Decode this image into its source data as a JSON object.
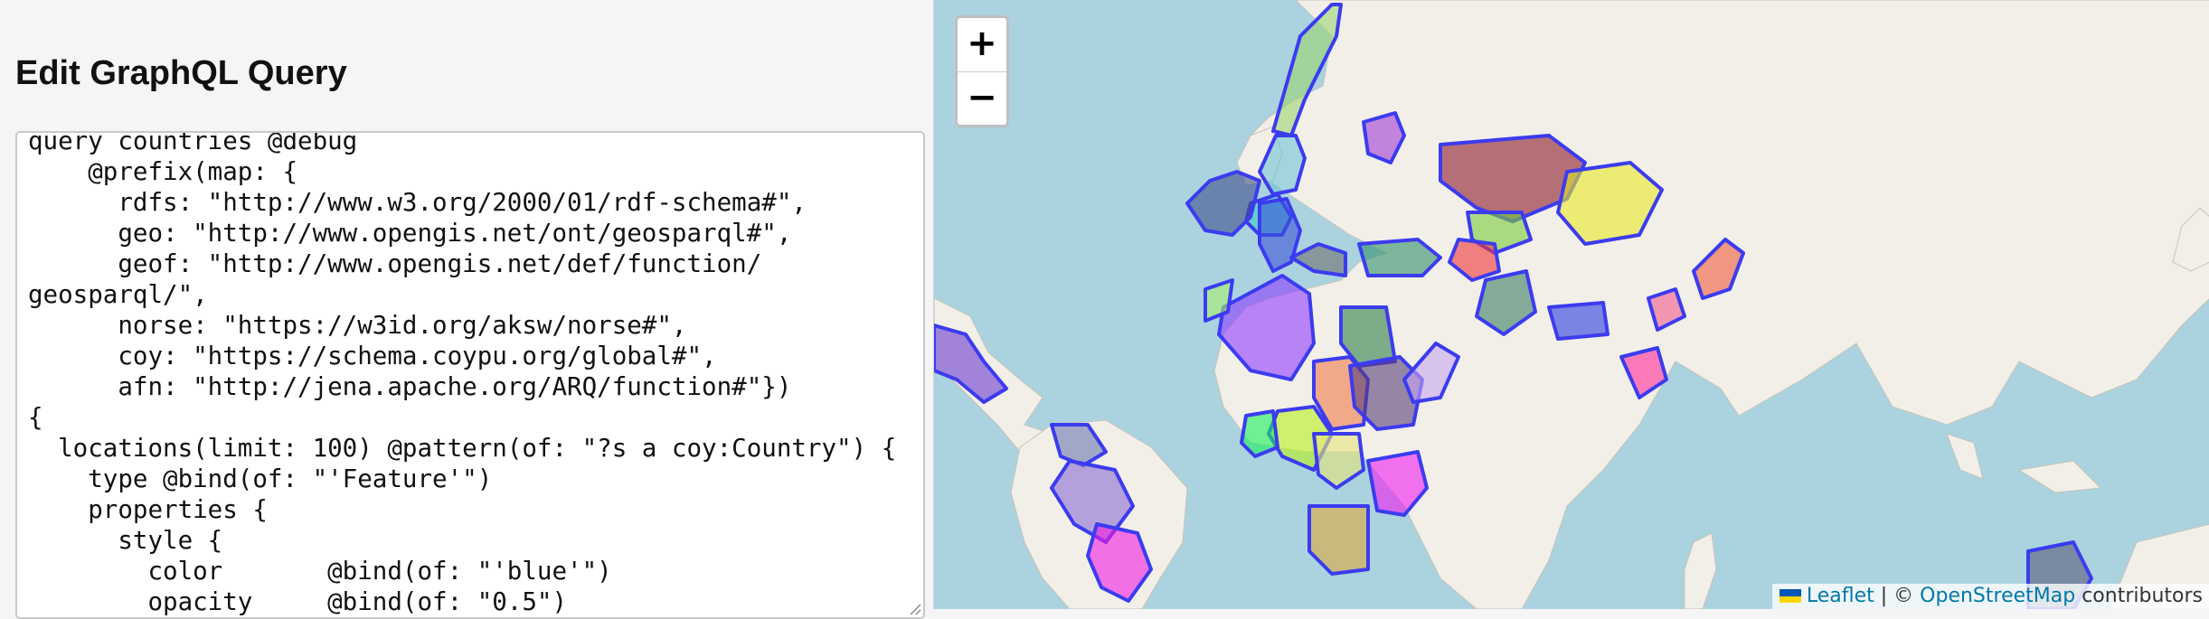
{
  "left_panel": {
    "title": "Edit GraphQL Query",
    "query_text": "query countries @debug\n    @prefix(map: {\n      rdfs: \"http://www.w3.org/2000/01/rdf-schema#\",\n      geo: \"http://www.opengis.net/ont/geosparql#\",\n      geof: \"http://www.opengis.net/def/function/\ngeosparql/\",\n      norse: \"https://w3id.org/aksw/norse#\",\n      coy: \"https://schema.coypu.org/global#\",\n      afn: \"http://jena.apache.org/ARQ/function#\"})\n{\n  locations(limit: 100) @pattern(of: \"?s a coy:Country\") {\n    type @bind(of: \"'Feature'\")\n    properties {\n      style {\n        color       @bind(of: \"'blue'\")\n        opacity     @bind(of: \"0.5\")"
  },
  "map": {
    "zoom_in_label": "+",
    "zoom_out_label": "−",
    "attribution": {
      "leaflet_label": "Leaflet",
      "separator": " | © ",
      "osm_label": "OpenStreetMap",
      "suffix": " contributors"
    },
    "country_outline_color": "#3b3bf0",
    "colors": {
      "water": "#aad3df",
      "land": "#f2efe9"
    }
  }
}
